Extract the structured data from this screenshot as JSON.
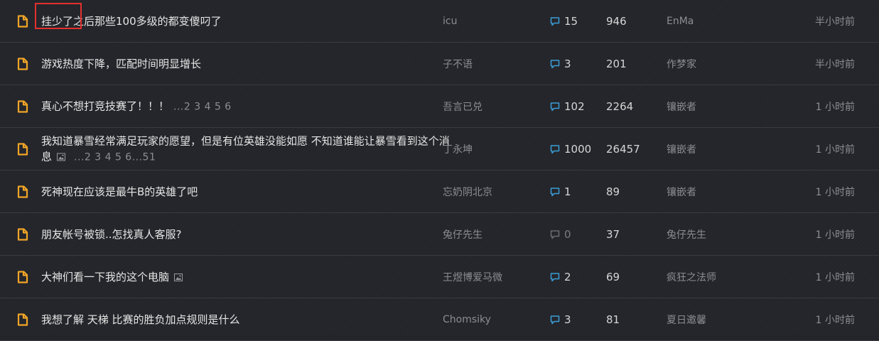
{
  "threads": [
    {
      "title": "挂少了之后那些100多级的都变傻叼了",
      "has_image": false,
      "pages": "",
      "author": "icu",
      "replies": "15",
      "views": "946",
      "last_poster": "EnMa",
      "time": "半小时前"
    },
    {
      "title": "游戏热度下降，匹配时间明显增长",
      "has_image": false,
      "pages": "",
      "author": "子不语",
      "replies": "3",
      "views": "201",
      "last_poster": "作梦家",
      "time": "半小时前"
    },
    {
      "title": "真心不想打竞技赛了！！！",
      "has_image": false,
      "pages": "...2 3 4 5 6",
      "author": "吾言已兑",
      "replies": "102",
      "views": "2264",
      "last_poster": "镶嵌者",
      "time": "1 小时前"
    },
    {
      "title": "我知道暴雪经常满足玩家的愿望，但是有位英雄没能如愿 不知道谁能让暴雪看到这个消息",
      "has_image": true,
      "pages": "...2 3 4 5 6...51",
      "author": "丁永坤",
      "replies": "1000",
      "views": "26457",
      "last_poster": "镶嵌者",
      "time": "1 小时前"
    },
    {
      "title": "死神现在应该是最牛B的英雄了吧",
      "has_image": false,
      "pages": "",
      "author": "忘奶阴北京",
      "replies": "1",
      "views": "89",
      "last_poster": "镶嵌者",
      "time": "1 小时前"
    },
    {
      "title": "朋友帐号被锁..怎找真人客服?",
      "has_image": false,
      "pages": "",
      "author": "兔仔先生",
      "replies": "0",
      "views": "37",
      "last_poster": "兔仔先生",
      "time": "1 小时前"
    },
    {
      "title": "大神们看一下我的这个电脑",
      "has_image": true,
      "pages": "",
      "author": "王煜博爱马微",
      "replies": "2",
      "views": "69",
      "last_poster": "疯狂之法师",
      "time": "1 小时前"
    },
    {
      "title": "我想了解 天梯 比赛的胜负加点规则是什么",
      "has_image": false,
      "pages": "",
      "author": "Chomsiky",
      "replies": "3",
      "views": "81",
      "last_poster": "夏日邀馨",
      "time": "1 小时前"
    }
  ],
  "colors": {
    "background": "#24252a",
    "file_icon": "#f0a527",
    "reply_icon": "#3a9ed8",
    "reply_icon_zero": "#6b6c70",
    "highlight_box": "#e3302e"
  },
  "icons": {
    "file": "document-icon",
    "image": "image-icon",
    "reply": "comment-bubble-icon"
  }
}
